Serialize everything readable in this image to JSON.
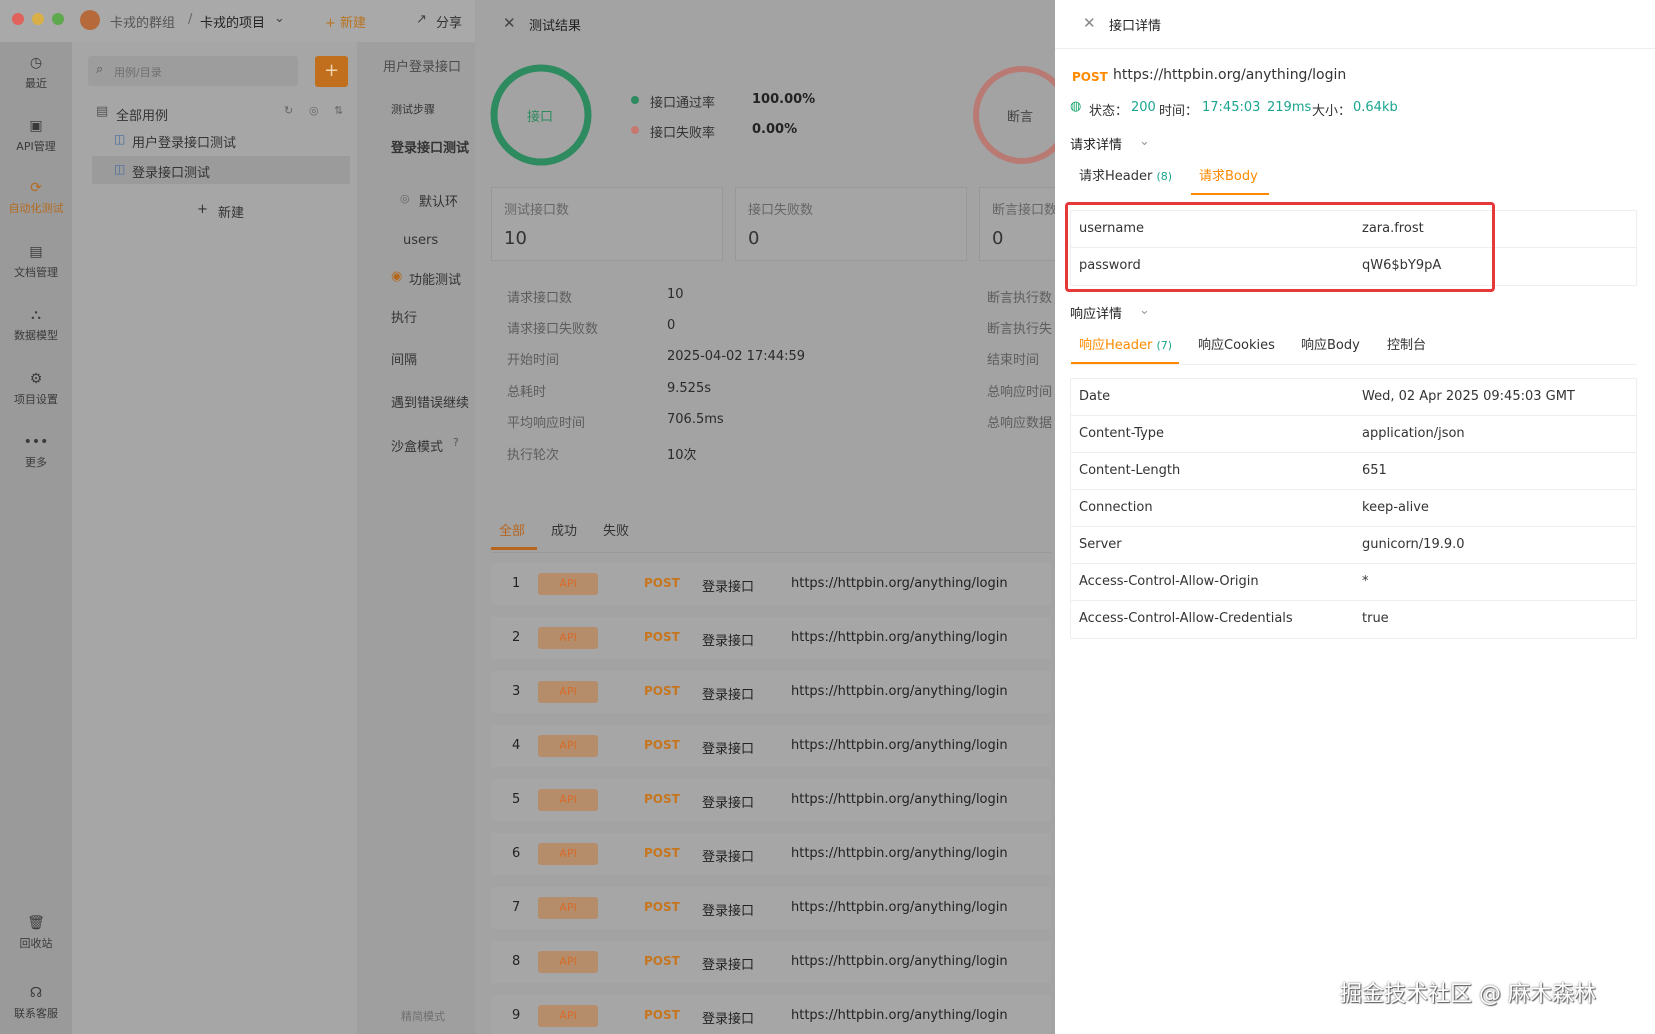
{
  "titlebar": {
    "team": "卡戎的群组",
    "sep": "/",
    "project": "卡戎的项目",
    "new": "+ 新建",
    "share": "分享"
  },
  "nav": [
    {
      "label": "最近",
      "icon": "clock-icon"
    },
    {
      "label": "API管理",
      "icon": "api-icon"
    },
    {
      "label": "自动化测试",
      "icon": "automation-icon"
    },
    {
      "label": "文档管理",
      "icon": "doc-icon"
    },
    {
      "label": "数据模型",
      "icon": "model-icon"
    },
    {
      "label": "项目设置",
      "icon": "settings-icon"
    },
    {
      "label": "更多",
      "icon": "more-icon"
    }
  ],
  "nav_bottom": [
    {
      "label": "回收站",
      "icon": "trash-icon"
    },
    {
      "label": "联系客服",
      "icon": "headset-icon"
    }
  ],
  "cases": {
    "search_placeholder": "用例/目录",
    "add": "+",
    "all": "全部用例",
    "items": [
      "用户登录接口测试",
      "登录接口测试"
    ],
    "new": "新建"
  },
  "mid": {
    "breadcrumb": "用户登录接口",
    "tab": "测试步骤",
    "title": "登录接口测试",
    "default": "默认环",
    "users": "users",
    "functional": "功能测试",
    "exec": "执行",
    "interval": "间隔",
    "on_error": "遇到错误继续",
    "sandbox": "沙盒模式",
    "footer": "精简模式"
  },
  "result": {
    "title": "测试结果",
    "circle_label": "接口",
    "circle2_label": "断言",
    "pass_rate_label": "接口通过率",
    "pass_rate": "100.00%",
    "fail_rate_label": "接口失败率",
    "fail_rate": "0.00%",
    "cards": [
      {
        "label": "测试接口数",
        "value": "10"
      },
      {
        "label": "接口失败数",
        "value": "0"
      },
      {
        "label": "断言接口数",
        "value": "0"
      }
    ],
    "rows": [
      {
        "label": "请求接口数",
        "value": "10"
      },
      {
        "label": "请求接口失败数",
        "value": "0"
      },
      {
        "label": "开始时间",
        "value": "2025-04-02 17:44:59"
      },
      {
        "label": "总耗时",
        "value": "9.525s"
      },
      {
        "label": "平均响应时间",
        "value": "706.5ms"
      },
      {
        "label": "执行轮次",
        "value": "10次"
      }
    ],
    "right_rows": [
      "断言执行数",
      "断言执行失",
      "结束时间",
      "总响应时间",
      "总响应数据"
    ],
    "tabs": [
      "全部",
      "成功",
      "失败"
    ],
    "list": [
      {
        "n": "1",
        "tag": "API",
        "method": "POST",
        "name": "登录接口",
        "url": "https://httpbin.org/anything/login"
      },
      {
        "n": "2",
        "tag": "API",
        "method": "POST",
        "name": "登录接口",
        "url": "https://httpbin.org/anything/login"
      },
      {
        "n": "3",
        "tag": "API",
        "method": "POST",
        "name": "登录接口",
        "url": "https://httpbin.org/anything/login"
      },
      {
        "n": "4",
        "tag": "API",
        "method": "POST",
        "name": "登录接口",
        "url": "https://httpbin.org/anything/login"
      },
      {
        "n": "5",
        "tag": "API",
        "method": "POST",
        "name": "登录接口",
        "url": "https://httpbin.org/anything/login"
      },
      {
        "n": "6",
        "tag": "API",
        "method": "POST",
        "name": "登录接口",
        "url": "https://httpbin.org/anything/login"
      },
      {
        "n": "7",
        "tag": "API",
        "method": "POST",
        "name": "登录接口",
        "url": "https://httpbin.org/anything/login"
      },
      {
        "n": "8",
        "tag": "API",
        "method": "POST",
        "name": "登录接口",
        "url": "https://httpbin.org/anything/login"
      },
      {
        "n": "9",
        "tag": "API",
        "method": "POST",
        "name": "登录接口",
        "url": "https://httpbin.org/anything/login"
      }
    ]
  },
  "detail": {
    "title": "接口详情",
    "method": "POST",
    "url": "https://httpbin.org/anything/login",
    "status_label": "状态：",
    "status": "200",
    "time_label": "时间：",
    "time": "17:45:03",
    "duration": "219ms",
    "size_label": "大小：",
    "size": "0.64kb",
    "req_section": "请求详情",
    "req_tabs": [
      {
        "label": "请求Header",
        "badge": "(8)"
      },
      {
        "label": "请求Body",
        "badge": ""
      }
    ],
    "req_body": [
      {
        "k": "username",
        "v": "zara.frost"
      },
      {
        "k": "password",
        "v": "qW6$bY9pA"
      }
    ],
    "resp_section": "响应详情",
    "resp_tabs": [
      {
        "label": "响应Header",
        "badge": "(7)"
      },
      {
        "label": "响应Cookies",
        "badge": ""
      },
      {
        "label": "响应Body",
        "badge": ""
      },
      {
        "label": "控制台",
        "badge": ""
      }
    ],
    "resp_headers": [
      {
        "k": "Date",
        "v": "Wed, 02 Apr 2025 09:45:03 GMT"
      },
      {
        "k": "Content-Type",
        "v": "application/json"
      },
      {
        "k": "Content-Length",
        "v": "651"
      },
      {
        "k": "Connection",
        "v": "keep-alive"
      },
      {
        "k": "Server",
        "v": "gunicorn/19.9.0"
      },
      {
        "k": "Access-Control-Allow-Origin",
        "v": "*"
      },
      {
        "k": "Access-Control-Allow-Credentials",
        "v": "true"
      }
    ]
  },
  "watermark": "掘金技术社区 @ 麻木森林",
  "colors": {
    "accent": "#ff8a00",
    "green": "#11a26b",
    "teal": "#1aa58f",
    "highlight": "#e5383b"
  }
}
